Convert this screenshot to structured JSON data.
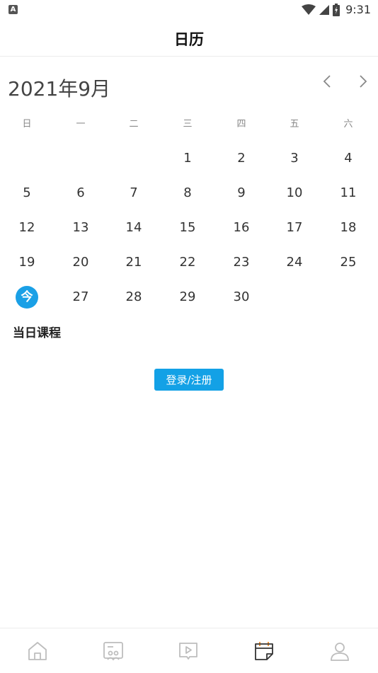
{
  "status_bar": {
    "time": "9:31",
    "app_icon_label": "A"
  },
  "header": {
    "title": "日历"
  },
  "calendar": {
    "month_title": "2021年9月",
    "prev_icon": "chevron-left-icon",
    "next_icon": "chevron-right-icon",
    "weekdays": [
      "日",
      "一",
      "二",
      "三",
      "四",
      "五",
      "六"
    ],
    "days": [
      "1",
      "2",
      "3",
      "4",
      "5",
      "6",
      "7",
      "8",
      "9",
      "10",
      "11",
      "12",
      "13",
      "14",
      "15",
      "16",
      "17",
      "18",
      "19",
      "20",
      "21",
      "22",
      "23",
      "24",
      "25",
      "今",
      "27",
      "28",
      "29",
      "30"
    ],
    "today_label": "今",
    "today_color": "#1aa0e6"
  },
  "courses": {
    "title": "当日课程"
  },
  "login": {
    "label": "登录/注册",
    "color": "#13a1e6"
  },
  "tabs": [
    {
      "icon": "home-icon",
      "active": false
    },
    {
      "icon": "classroom-icon",
      "active": false
    },
    {
      "icon": "video-icon",
      "active": false
    },
    {
      "icon": "calendar-icon",
      "active": true
    },
    {
      "icon": "user-icon",
      "active": false
    }
  ]
}
